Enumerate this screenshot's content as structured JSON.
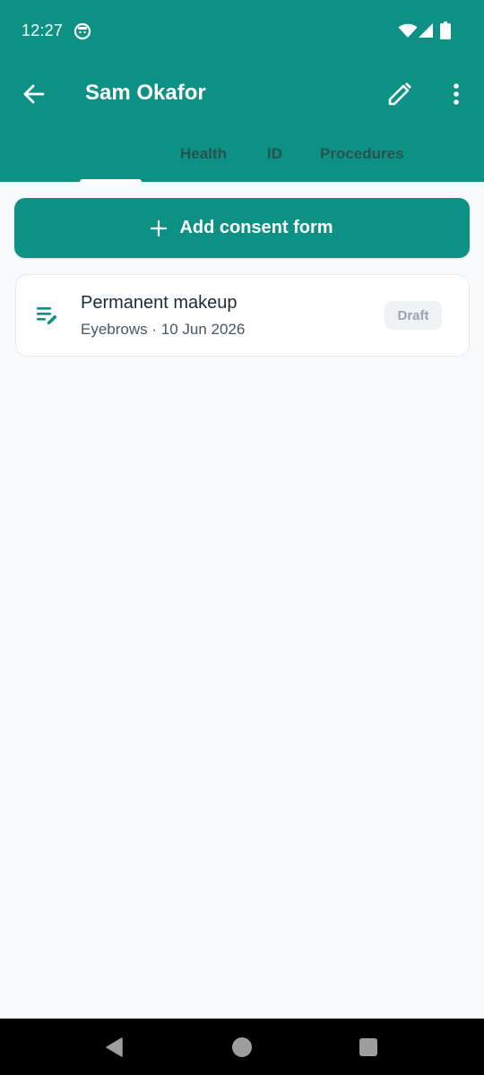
{
  "status_bar": {
    "time": "12:27"
  },
  "toolbar": {
    "title": "Sam Okafor"
  },
  "tabs": [
    {
      "label": "Health"
    },
    {
      "label": "ID"
    },
    {
      "label": "Procedures"
    }
  ],
  "add_button": {
    "label": "Add consent form"
  },
  "consent_forms": [
    {
      "title": "Permanent makeup",
      "subtitle": "Eyebrows · 10 Jun 2026",
      "status": "Draft"
    }
  ],
  "icons": {
    "status": [
      "face-icon",
      "wifi-icon",
      "signal-icon",
      "battery-icon"
    ],
    "toolbar": [
      "back-arrow-icon",
      "edit-pencil-icon",
      "more-vert-icon"
    ],
    "button": "plus-icon",
    "card": "edit-note-icon",
    "navigation": [
      "nav-back-icon",
      "nav-home-icon",
      "nav-recents-icon"
    ]
  },
  "colors": {
    "primary": "#0E9185",
    "background": "#F8FAFC",
    "card": "#FFFFFF",
    "badge_bg": "#EEF2F5",
    "badge_text": "#9AA5B1",
    "nav_bar": "#000000"
  }
}
